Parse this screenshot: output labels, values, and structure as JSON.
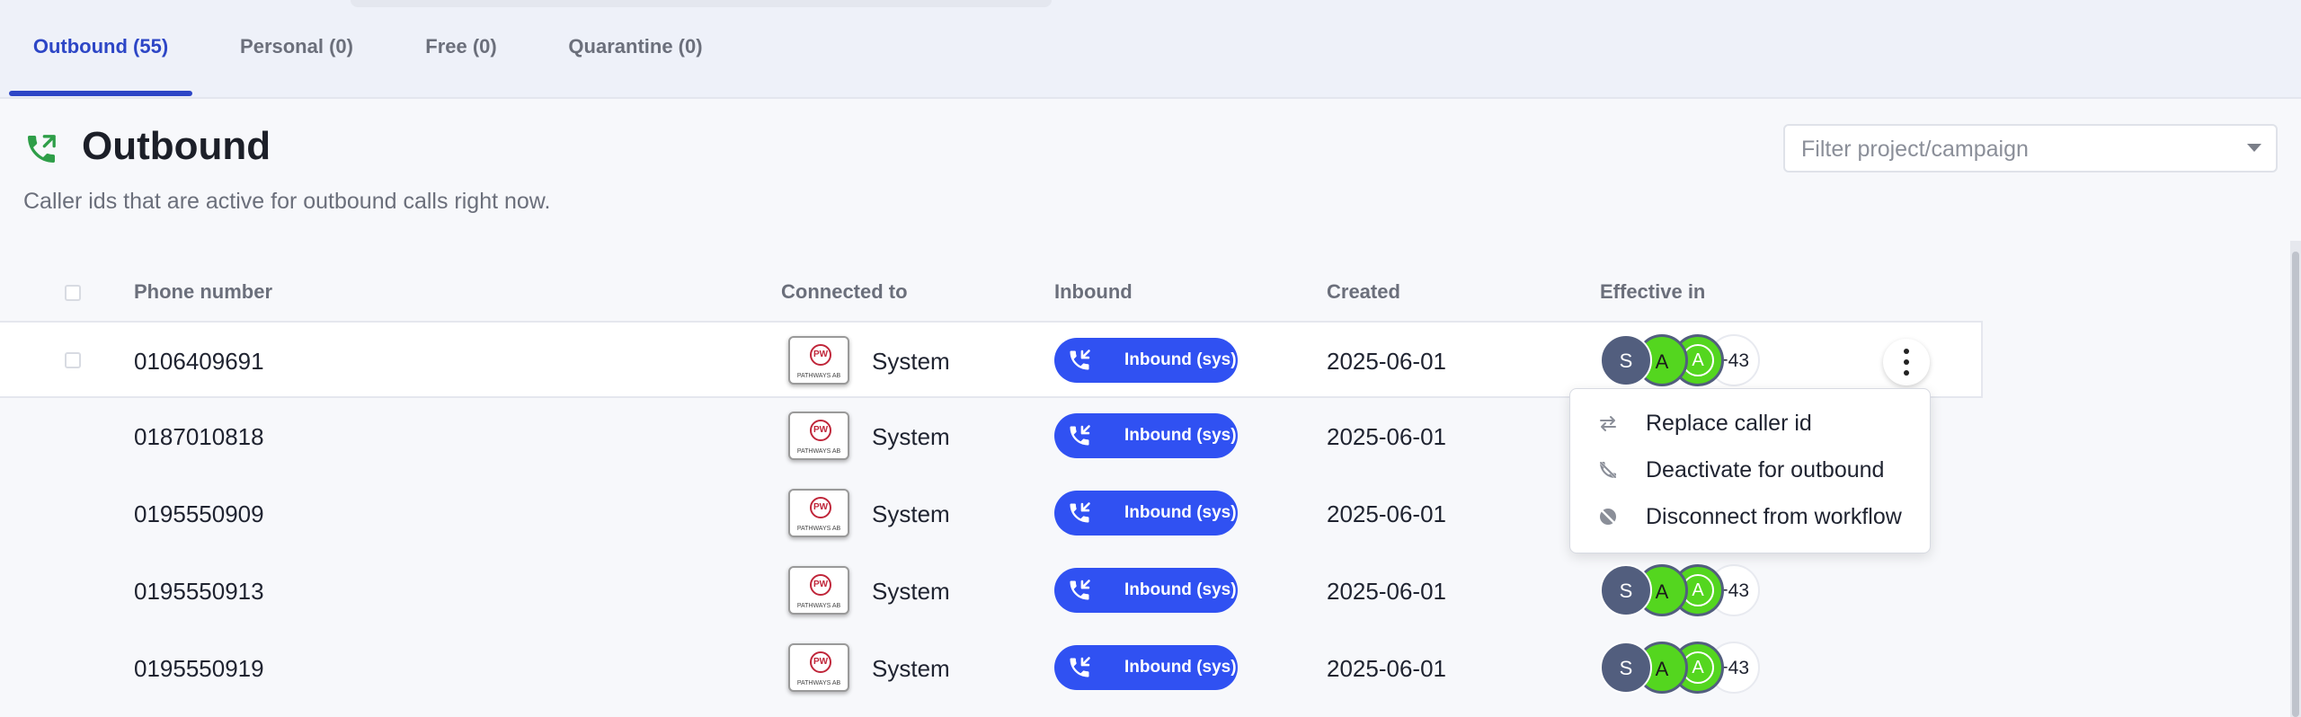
{
  "tabs": [
    {
      "label": "Outbound (55)",
      "active": true
    },
    {
      "label": "Personal (0)",
      "active": false
    },
    {
      "label": "Free (0)",
      "active": false
    },
    {
      "label": "Quarantine (0)",
      "active": false
    }
  ],
  "header": {
    "icon": "phone-outgoing-icon",
    "title": "Outbound",
    "subtitle": "Caller ids that are active for outbound calls right now."
  },
  "filter": {
    "placeholder": "Filter project/campaign",
    "value": ""
  },
  "table": {
    "columns": [
      "Phone number",
      "Connected to",
      "Inbound",
      "Created",
      "Effective in"
    ],
    "rows": [
      {
        "phone": "0106409691",
        "logo_text": "PW",
        "logo_caption": "PATHWAYS AB",
        "connected": "System",
        "inbound": "Inbound (sys)",
        "created": "2025-06-01",
        "avatars": [
          "S",
          "A",
          "A"
        ],
        "more": "+43"
      },
      {
        "phone": "0187010818",
        "logo_text": "PW",
        "logo_caption": "PATHWAYS AB",
        "connected": "System",
        "inbound": "Inbound (sys)",
        "created": "2025-06-01",
        "avatars": [],
        "more": ""
      },
      {
        "phone": "0195550909",
        "logo_text": "PW",
        "logo_caption": "PATHWAYS AB",
        "connected": "System",
        "inbound": "Inbound (sys)",
        "created": "2025-06-01",
        "avatars": [],
        "more": ""
      },
      {
        "phone": "0195550913",
        "logo_text": "PW",
        "logo_caption": "PATHWAYS AB",
        "connected": "System",
        "inbound": "Inbound (sys)",
        "created": "2025-06-01",
        "avatars": [
          "S",
          "A",
          "A"
        ],
        "more": "+43"
      },
      {
        "phone": "0195550919",
        "logo_text": "PW",
        "logo_caption": "PATHWAYS AB",
        "connected": "System",
        "inbound": "Inbound (sys)",
        "created": "2025-06-01",
        "avatars": [
          "S",
          "A",
          "A"
        ],
        "more": "+43"
      }
    ]
  },
  "context_menu": {
    "items": [
      {
        "label": "Replace caller id",
        "icon": "swap-icon"
      },
      {
        "label": "Deactivate for outbound",
        "icon": "phone-off-icon"
      },
      {
        "label": "Disconnect from workflow",
        "icon": "disconnect-icon"
      }
    ]
  },
  "colors": {
    "accent": "#2d46c6",
    "inbound_pill": "#3051f2",
    "avatar_green": "#54d61f",
    "avatar_slate": "#525e7e",
    "icon_green": "#2e9e48"
  }
}
